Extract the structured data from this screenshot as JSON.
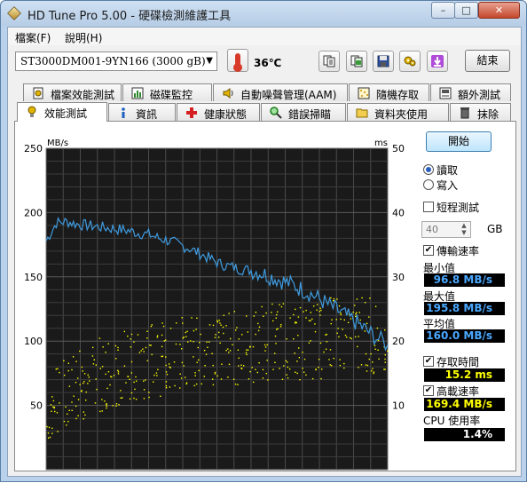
{
  "window": {
    "title": "HD Tune Pro 5.00 - 硬碟檢測維護工具",
    "buttons": {
      "minimize": "–",
      "maximize": "□",
      "close": "✕"
    }
  },
  "menu": [
    "檔案(F)",
    "說明(H)"
  ],
  "toolbar": {
    "drive": "ST3000DM001-9YN166    (3000 gB)",
    "temperature": "36℃",
    "exit_label": "結束",
    "icons": [
      "copy-text-icon",
      "copy-screenshot-icon",
      "save-icon",
      "options-icon",
      "download-icon"
    ]
  },
  "tabs": {
    "row1": [
      {
        "label": "檔案效能測試",
        "icon": "file-benchmark-icon"
      },
      {
        "label": "磁碟監控",
        "icon": "disk-monitor-icon"
      },
      {
        "label": "自動噪聲管理(AAM)",
        "icon": "speaker-icon"
      },
      {
        "label": "隨機存取",
        "icon": "random-access-icon"
      },
      {
        "label": "額外測試",
        "icon": "extra-tests-icon"
      }
    ],
    "row2": [
      {
        "label": "效能測試",
        "icon": "benchmark-icon",
        "active": true
      },
      {
        "label": "資訊",
        "icon": "info-icon"
      },
      {
        "label": "健康狀態",
        "icon": "health-cross-icon"
      },
      {
        "label": "錯誤掃瞄",
        "icon": "magnifier-icon"
      },
      {
        "label": "資料夾使用",
        "icon": "folder-icon"
      },
      {
        "label": "抹除",
        "icon": "trash-icon"
      }
    ]
  },
  "controls": {
    "start_label": "開始",
    "read_label": "讀取",
    "write_label": "寫入",
    "mode": "read",
    "short_test_label": "短程測試",
    "short_test_checked": false,
    "short_test_size": "40",
    "short_test_unit": "GB",
    "transfer_rate_label": "傳輸速率",
    "transfer_rate_checked": true,
    "min_label": "最小值",
    "min_value": "96.8 MB/s",
    "max_label": "最大值",
    "max_value": "195.8 MB/s",
    "avg_label": "平均值",
    "avg_value": "160.0 MB/s",
    "access_time_label": "存取時間",
    "access_time_checked": true,
    "access_time_value": "15.2 ms",
    "burst_rate_label": "高載速率",
    "burst_rate_checked": true,
    "burst_rate_value": "169.4 MB/s",
    "cpu_label": "CPU 使用率",
    "cpu_value": "1.4%"
  },
  "chart_data": {
    "type": "line",
    "left_unit": "MB/s",
    "right_unit": "ms",
    "left_ylim": [
      0,
      250
    ],
    "right_ylim": [
      0,
      50
    ],
    "left_ticks": [
      "250",
      "200",
      "150",
      "100",
      "50"
    ],
    "right_ticks": [
      "50",
      "40",
      "30",
      "20",
      "10"
    ],
    "grid": true,
    "x": [
      0,
      3,
      6,
      9,
      12,
      15,
      18,
      21,
      24,
      27,
      30,
      33,
      36,
      39,
      42,
      45,
      48,
      51,
      54,
      57,
      60,
      63,
      66,
      69,
      72,
      75,
      78,
      81,
      84,
      87,
      90,
      93,
      96,
      100
    ],
    "series": [
      {
        "axis": "left",
        "color": "#3f9be0",
        "values": [
          178,
          192,
          193,
          191,
          190,
          189,
          188,
          187,
          186,
          184,
          183,
          180,
          178,
          175,
          172,
          168,
          164,
          160,
          158,
          156,
          155,
          153,
          150,
          147,
          144,
          140,
          136,
          131,
          126,
          121,
          116,
          110,
          104,
          97
        ]
      },
      {
        "axis": "right",
        "color": "#ffff00",
        "style": "scatter",
        "values": [
          9,
          11,
          12,
          13,
          14,
          15,
          15,
          16,
          16,
          17,
          17,
          17,
          18,
          18,
          18,
          18,
          19,
          19,
          19,
          19,
          19,
          20,
          20,
          20,
          20,
          20,
          20,
          20,
          21,
          21,
          21,
          21,
          21,
          21
        ]
      }
    ]
  }
}
